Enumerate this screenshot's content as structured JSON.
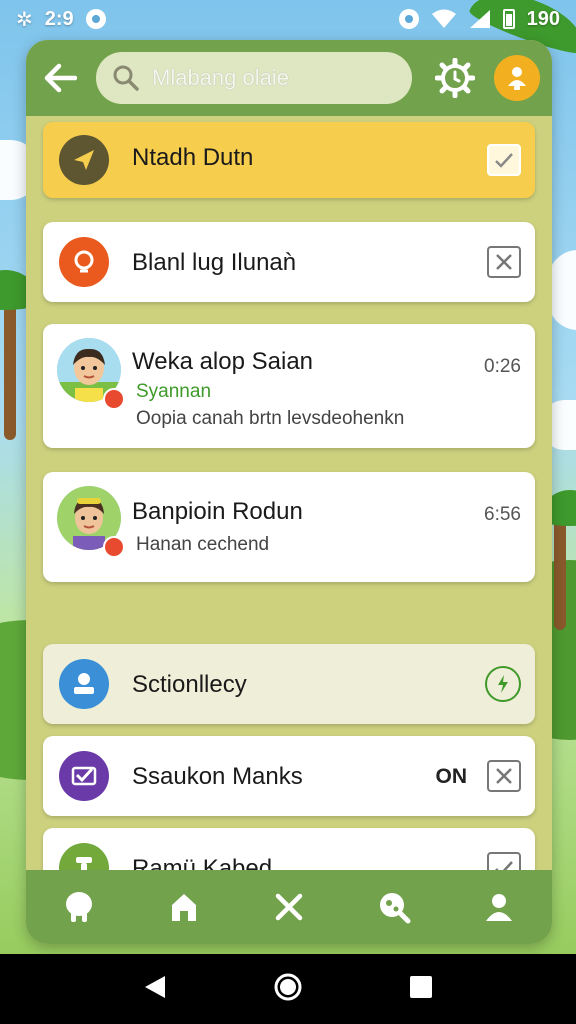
{
  "status_bar": {
    "time": "2:9",
    "battery": "190"
  },
  "search": {
    "placeholder": "Mlabang olaie"
  },
  "items": [
    {
      "title": "Ntadh Dutn",
      "icon": "send-icon",
      "action": "checkmark",
      "accent": "#5d5630"
    },
    {
      "title": "Blanl lug Ilunaǹ",
      "icon": "lightbulb-icon",
      "action": "close",
      "accent": "#ea5a1e"
    },
    {
      "title": "Weka alop Saian",
      "subtitle": "Syannan",
      "preview": "Oopia canah brtn levsdeohenkn",
      "time": "0:26"
    },
    {
      "title": "Banpioin Rodun",
      "preview": "Hanan cechend",
      "time": "6:56"
    },
    {
      "title": "Sctionllecy",
      "icon": "user-card-icon",
      "action": "power",
      "accent": "#3a8fd6"
    },
    {
      "title": "Ssaukon Manks",
      "meta": "ON",
      "icon": "mail-check-icon",
      "action": "close",
      "accent": "#6a3aa8"
    },
    {
      "title": "Ramü Kabed",
      "icon": "tool-icon",
      "action": "checkmark",
      "accent": "#72a93a"
    }
  ],
  "colors": {
    "bar_green": "#73a24c",
    "panel": "#cdd17e",
    "highlight": "#f7cd4d"
  }
}
